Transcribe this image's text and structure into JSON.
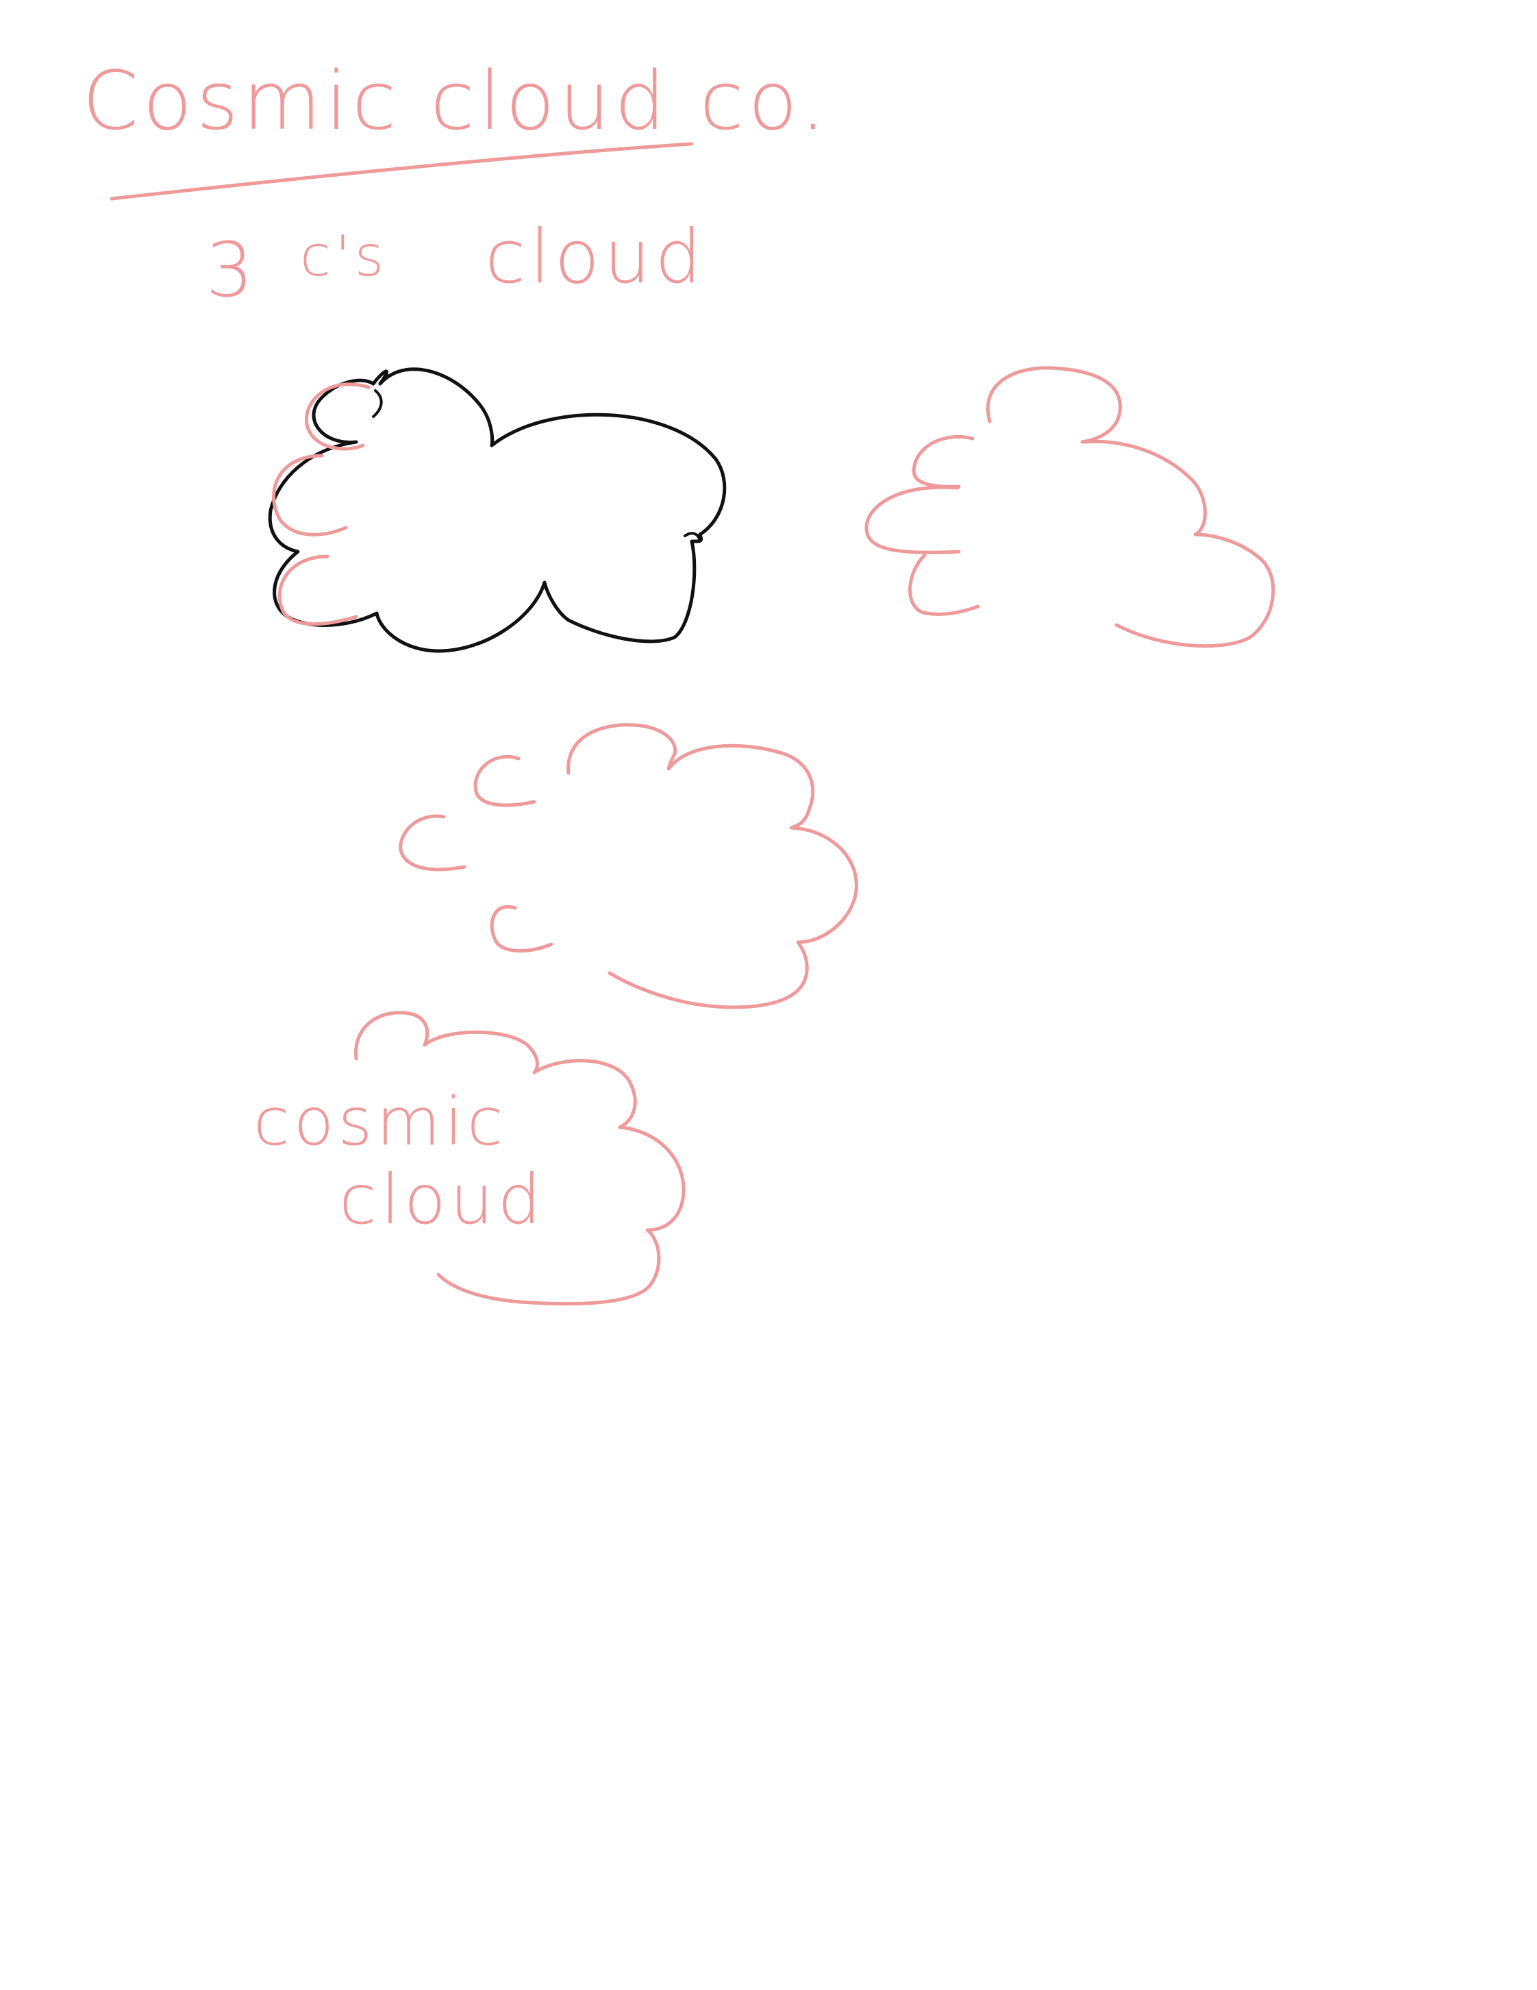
{
  "sketch": {
    "title": "Cosmic cloud co.",
    "subtitle_number": "3",
    "subtitle_cs": "c's",
    "subtitle_word": "cloud",
    "cloud_label_line1": "cosmic",
    "cloud_label_line2": "cloud",
    "letter_c": "c"
  },
  "colors": {
    "pink_ink": "#ef9a9a",
    "black_ink": "#111111",
    "paper": "#ffffff"
  }
}
